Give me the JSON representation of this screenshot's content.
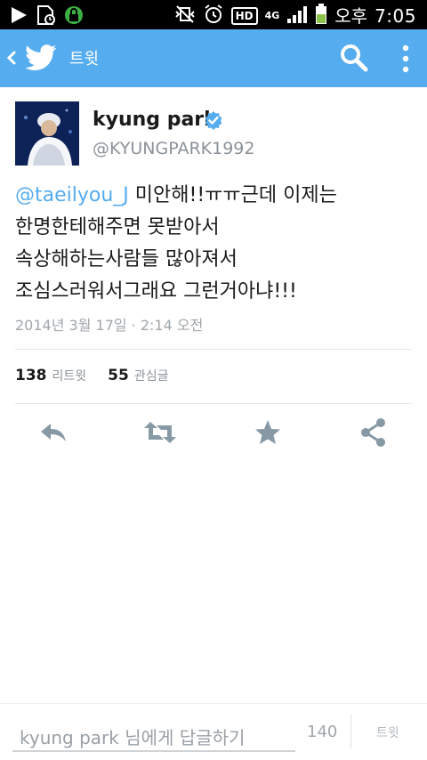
{
  "status_bar": {
    "hd_label": "HD",
    "network_label": "4G",
    "time_period": "오후",
    "time": "7:05"
  },
  "app_bar": {
    "title": "트윗"
  },
  "tweet": {
    "author_name": "kyung park",
    "author_handle": "@KYUNGPARK1992",
    "mention": "@taeilyou_J",
    "text_line1_rest": " 미안해!!ㅠㅠ근데 이제는",
    "text_line2": "한명한테해주면 못받아서",
    "text_line3": "속상해하는사람들 많아져서",
    "text_line4": "조심스러워서그래요 그런거아냐!!!",
    "timestamp": "2014년 3월 17일 · 2:14 오전"
  },
  "stats": {
    "retweet_count": "138",
    "retweet_label": "리트윗",
    "favorite_count": "55",
    "favorite_label": "관심글"
  },
  "reply_bar": {
    "placeholder": "kyung park 님에게 답글하기",
    "char_count": "140",
    "tweet_button": "트윗"
  },
  "colors": {
    "accent": "#55acee",
    "action_icon": "#8899a6"
  }
}
